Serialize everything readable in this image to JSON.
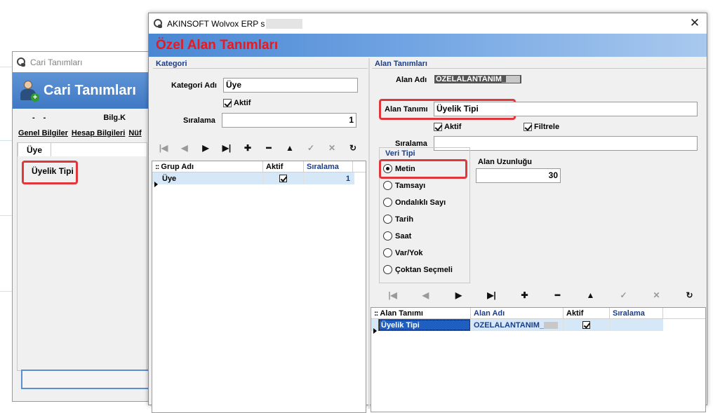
{
  "back_window": {
    "title": "Cari Tanımları",
    "banner_title": "Cari Tanımları",
    "info_dash1": "-",
    "info_dash2": "-",
    "info_bilg": "Bilg.K",
    "tabs": [
      "Genel Bilgiler",
      "Hesap Bilgileri",
      "Nüf"
    ],
    "subtab": "Üye",
    "field_label": "Üyelik Tipi"
  },
  "front_window": {
    "title": "AKINSOFT Wolvox ERP s",
    "close_glyph": "✕",
    "banner_title": "Özel Alan Tanımları"
  },
  "kategori": {
    "group_title": "Kategori",
    "kategori_adi_label": "Kategori Adı",
    "kategori_adi_value": "Üye",
    "aktif_label": "Aktif",
    "aktif_checked": true,
    "siralama_label": "Sıralama",
    "siralama_value": "1",
    "grid": {
      "headers": [
        "Grup Adı",
        "Aktif",
        "Sıralama"
      ],
      "rows": [
        {
          "grup_adi": "Üye",
          "aktif": true,
          "siralama": "1"
        }
      ]
    }
  },
  "alan": {
    "group_title": "Alan Tanımları",
    "alan_adi_label": "Alan Adı",
    "alan_adi_value": "OZELALANTANIM_",
    "alan_tanimi_label": "Alan Tanımı",
    "alan_tanimi_value": "Üyelik Tipi",
    "aktif_label": "Aktif",
    "filtrele_label": "Filtrele",
    "siralama_label": "Sıralama",
    "siralama_value": "",
    "veri_tipi_title": "Veri Tipi",
    "veri_tipi_options": [
      "Metin",
      "Tamsayı",
      "Ondalıklı Sayı",
      "Tarih",
      "Saat",
      "Var/Yok",
      "Çoktan Seçmeli"
    ],
    "veri_tipi_selected": "Metin",
    "alan_uzunlugu_label": "Alan Uzunluğu",
    "alan_uzunlugu_value": "30",
    "grid": {
      "headers": [
        "Alan Tanımı",
        "Alan Adı",
        "Aktif",
        "Sıralama"
      ],
      "rows": [
        {
          "alan_tanimi": "Üyelik Tipi",
          "alan_adi": "OZELALANTANIM_",
          "aktif": true,
          "siralama": ""
        }
      ]
    }
  },
  "navigator": {
    "first": "|◀",
    "prev": "◀",
    "next": "▶",
    "last": "▶|",
    "add": "✚",
    "delete": "━",
    "edit": "▲",
    "post": "✓",
    "cancel": "✕",
    "refresh": "↻"
  },
  "colors": {
    "highlight": "#e0373d",
    "banner_title_red": "#e8191f",
    "group_header_blue": "#1a3d8a",
    "selection_blue": "#1f5fbf"
  }
}
